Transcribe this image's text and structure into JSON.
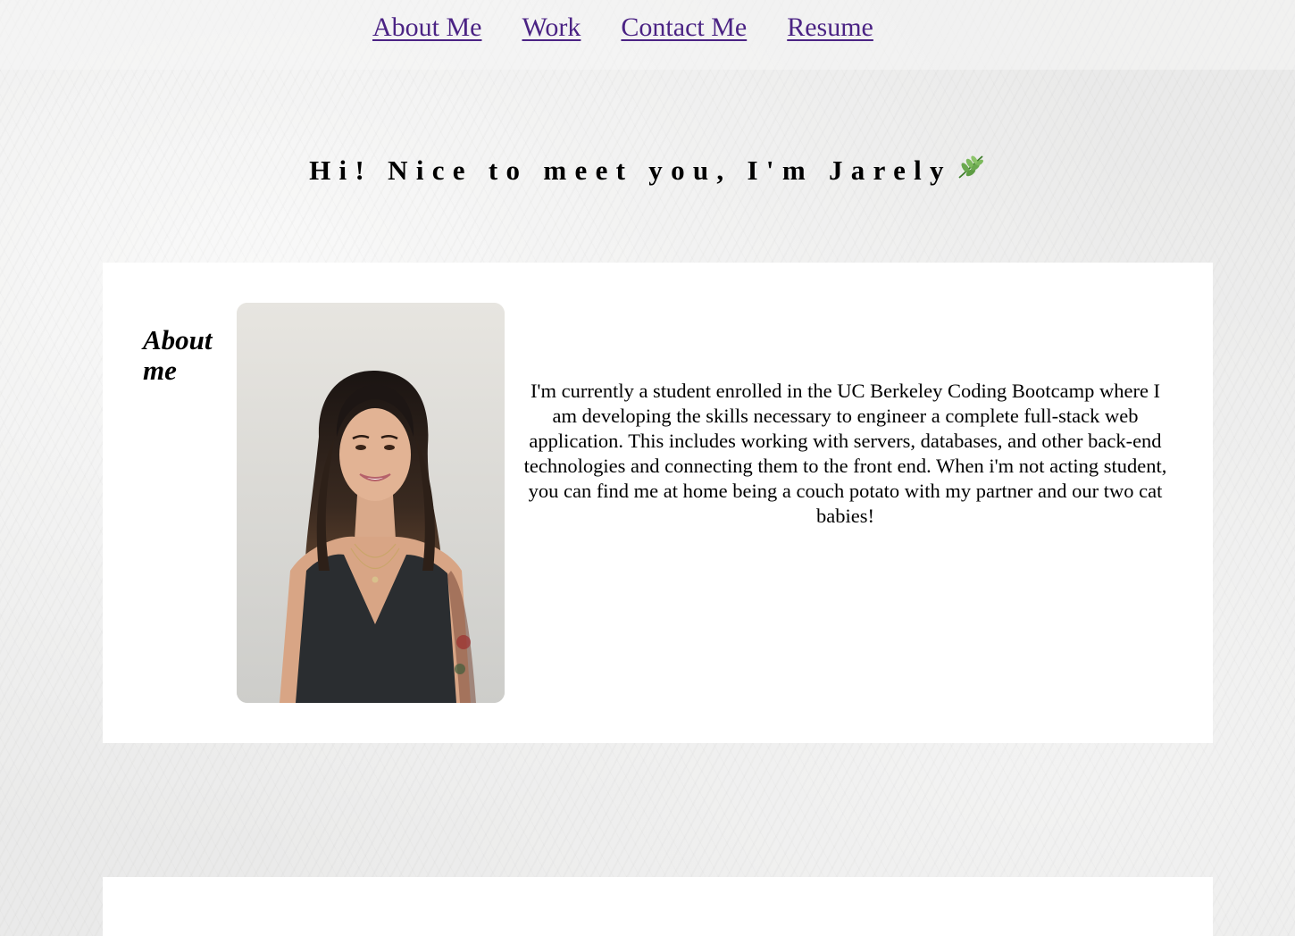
{
  "nav": {
    "items": [
      {
        "label": "About Me"
      },
      {
        "label": "Work"
      },
      {
        "label": "Contact Me"
      },
      {
        "label": "Resume"
      }
    ]
  },
  "hero": {
    "title": "Hi! Nice to meet you, I'm Jarely",
    "icon": "leaf-icon"
  },
  "about": {
    "heading": "About me",
    "photo_icon": "portrait-photo",
    "text": "I'm currently a student enrolled in the UC Berkeley Coding Bootcamp where I am developing the skills necessary to engineer a complete full-stack web application. This includes working with servers, databases, and other back-end technologies and connecting them to the front end. When i'm not acting student, you can find me at home being a couch potato with my partner and our two cat babies!"
  },
  "colors": {
    "link": "#4b2384",
    "card": "#ffffff",
    "background": "#f1f1f0"
  }
}
